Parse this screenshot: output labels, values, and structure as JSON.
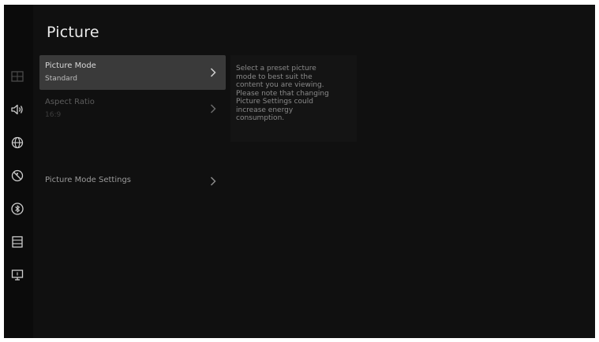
{
  "page": {
    "title": "Picture"
  },
  "menu": {
    "items": [
      {
        "label": "Picture Mode",
        "value": "Standard",
        "state": "selected"
      },
      {
        "label": "Aspect Ratio",
        "value": "16:9",
        "state": "disabled"
      },
      {
        "label": "Picture Mode Settings",
        "value": "",
        "state": "normal"
      }
    ]
  },
  "description": {
    "text": "Select a preset picture\nmode to best suit the\ncontent you are viewing.\nPlease note that changing\nPicture Settings could\nincrease energy\nconsumption."
  },
  "sidebar": {
    "icons": [
      "picture-icon",
      "sound-icon",
      "network-icon",
      "accessibility-icon",
      "bluetooth-icon",
      "storage-icon",
      "system-icon"
    ]
  },
  "colors": {
    "background": "#101010",
    "selected_row": "#3a3a3a",
    "text_primary": "#eaeaea",
    "text_secondary": "#8a8a8a"
  }
}
